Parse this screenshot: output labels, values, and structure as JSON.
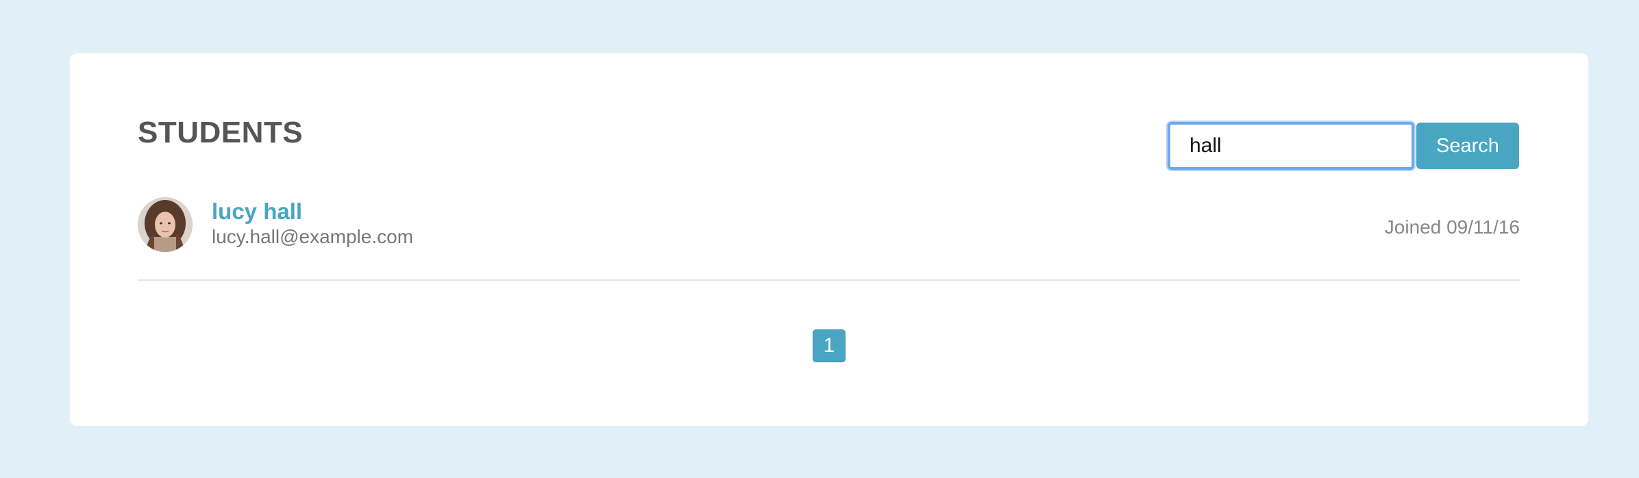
{
  "page": {
    "title": "STUDENTS"
  },
  "search": {
    "value": "hall",
    "button_label": "Search"
  },
  "students": [
    {
      "name": "lucy hall",
      "email": "lucy.hall@example.com",
      "joined": "Joined 09/11/16",
      "avatar_icon": "user-photo"
    }
  ],
  "pagination": {
    "pages": [
      "1"
    ],
    "current": "1"
  },
  "colors": {
    "background": "#e1f0f6",
    "accent": "#48a6c2",
    "title": "#555555",
    "muted": "#888888",
    "focus_ring": "#6ea8f0"
  }
}
